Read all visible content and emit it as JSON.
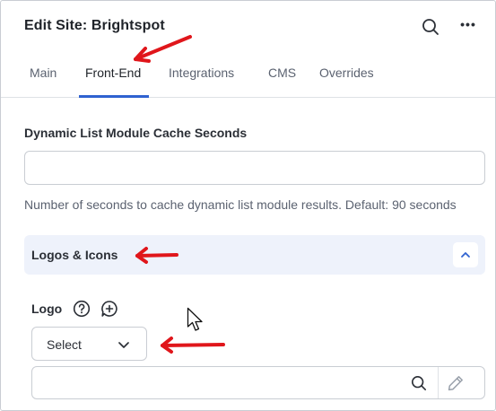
{
  "header": {
    "title": "Edit Site: Brightspot",
    "search_icon": "search-icon",
    "more_icon": "more-horizontal-icon",
    "more_glyph": "•••"
  },
  "tabs": [
    {
      "label": "Main",
      "active": false
    },
    {
      "label": "Front-End",
      "active": true
    },
    {
      "label": "Integrations",
      "active": false
    },
    {
      "label": "CMS",
      "active": false
    },
    {
      "label": "Overrides",
      "active": false
    }
  ],
  "cache_field": {
    "label": "Dynamic List Module Cache Seconds",
    "value": "",
    "placeholder": "",
    "help": "Number of seconds to cache dynamic list module results. Default: 90 seconds"
  },
  "logos_section": {
    "title": "Logos & Icons",
    "expanded": true,
    "toggle_icon": "chevron-up-icon"
  },
  "logo_field": {
    "label": "Logo",
    "help_icon": "help-circle-icon",
    "add_note_icon": "comment-add-icon",
    "select_value": "Select",
    "search_value": "",
    "search_icon": "search-icon",
    "edit_icon": "pencil-icon"
  },
  "colors": {
    "accent": "#2f62d0",
    "section_bg": "#eef2fb",
    "annotation_red": "#e0161b"
  }
}
